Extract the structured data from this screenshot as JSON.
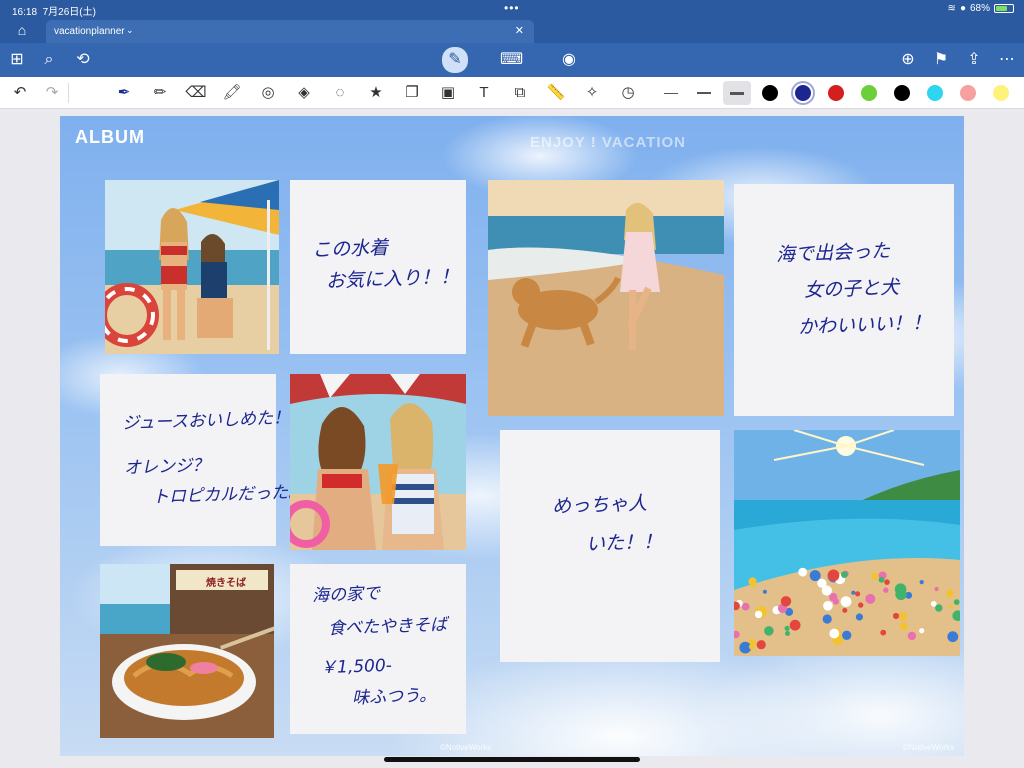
{
  "status": {
    "time": "16:18",
    "date": "7月26日(土)",
    "battery": "68%",
    "battery_level": 0.68
  },
  "tab": {
    "label": "vacationplanner"
  },
  "colors": {
    "accent": "#2c5aa0",
    "ink": "#1c2690"
  },
  "toolbar_icons": [
    "grid-icon",
    "search-icon",
    "lasso-rotate-icon",
    "pen-mode-icon",
    "keyboard-icon",
    "voice-icon",
    "add-page-icon",
    "bookmark-icon",
    "share-icon",
    "more-icon"
  ],
  "tools": [
    "pen",
    "pencil",
    "eraser",
    "highlighter",
    "shape",
    "elements",
    "lasso",
    "sticker",
    "copy",
    "image",
    "text",
    "scan-image",
    "ruler",
    "laser-pointer",
    "recent"
  ],
  "swatches": [
    "#000000",
    "#1c2690",
    "#d41f1f",
    "#6ccf3a",
    "#000000",
    "#2fd4ef",
    "#f6a0a0",
    "#fff27a"
  ],
  "album": {
    "title": "ALBUM",
    "watermark": "ENJOY ! VACATION",
    "credit_center": "©NotiveWorks",
    "credit_right": "©NotiveWorks"
  },
  "notes": {
    "swimsuit": [
      "この水着",
      "お気に入り！！"
    ],
    "dog_girl": [
      "海で出会った",
      "女の子と犬",
      "かわいいい！！"
    ],
    "juice": [
      "ジュースおいしめた！",
      "オレンジ？",
      "トロピカルだった。"
    ],
    "crowd": [
      "めっちゃ人",
      "いた！！"
    ],
    "yakisoba": [
      "海の家で",
      "食べたやきそば",
      "￥1,500-",
      "味ふつう。"
    ]
  },
  "photos": {
    "yakisoba_sign": "焼きそば"
  }
}
